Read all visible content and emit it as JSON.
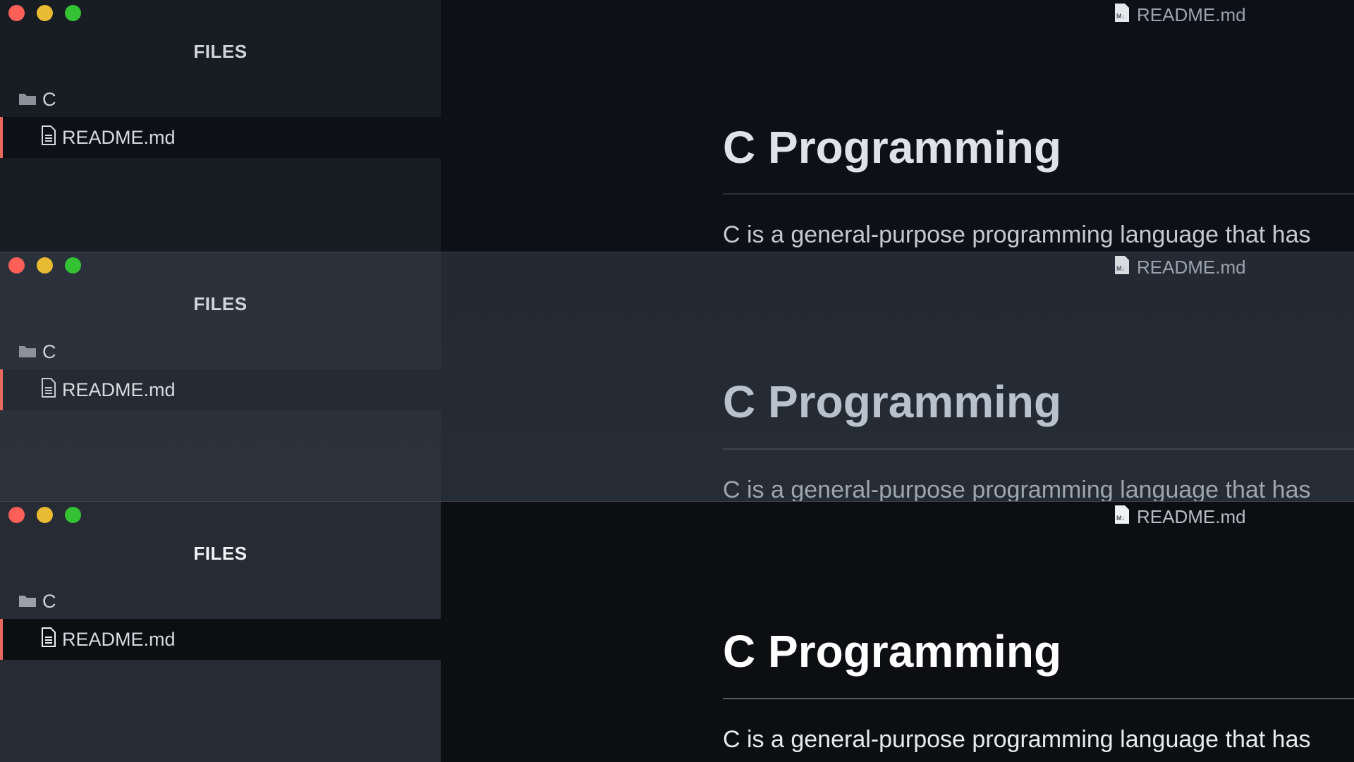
{
  "windows": [
    {
      "sidebar_title": "FILES",
      "folder": "C",
      "file": "README.md",
      "tab_title": "README.md",
      "heading": "C Programming",
      "paragraph": "C is a general-purpose programming language that has"
    },
    {
      "sidebar_title": "FILES",
      "folder": "C",
      "file": "README.md",
      "tab_title": "README.md",
      "heading": "C Programming",
      "paragraph": "C is a general-purpose programming language that has"
    },
    {
      "sidebar_title": "FILES",
      "folder": "C",
      "file": "README.md",
      "tab_title": "README.md",
      "heading": "C Programming",
      "paragraph": "C is a general-purpose programming language that has"
    }
  ],
  "icons": {
    "folder": "folder-icon",
    "file": "file-icon",
    "markdown": "markdown-file-icon"
  },
  "colors": {
    "close": "#fe5f57",
    "minimize": "#e8bb33",
    "zoom": "#35c134",
    "active_accent": "#e9685d"
  }
}
